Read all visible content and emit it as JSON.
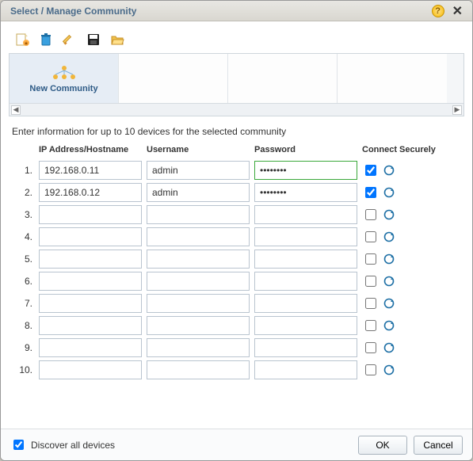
{
  "title": "Select / Manage Community",
  "toolbar": {
    "items": [
      {
        "name": "new-icon"
      },
      {
        "name": "delete-icon"
      },
      {
        "name": "edit-icon"
      },
      {
        "name": "save-icon"
      },
      {
        "name": "open-icon"
      }
    ]
  },
  "community": {
    "new_label": "New Community"
  },
  "scroll": {
    "left": "◀",
    "right": "▶"
  },
  "prompt": "Enter information for up to 10 devices for the selected community",
  "headers": {
    "ip": "IP Address/Hostname",
    "user": "Username",
    "pass": "Password",
    "secure": "Connect Securely"
  },
  "rows": [
    {
      "n": "1.",
      "ip": "192.168.0.11",
      "user": "admin",
      "pass": "********",
      "secure": true,
      "highlight": true
    },
    {
      "n": "2.",
      "ip": "192.168.0.12",
      "user": "admin",
      "pass": "********",
      "secure": true,
      "highlight": false
    },
    {
      "n": "3.",
      "ip": "",
      "user": "",
      "pass": "",
      "secure": false,
      "highlight": false
    },
    {
      "n": "4.",
      "ip": "",
      "user": "",
      "pass": "",
      "secure": false,
      "highlight": false
    },
    {
      "n": "5.",
      "ip": "",
      "user": "",
      "pass": "",
      "secure": false,
      "highlight": false
    },
    {
      "n": "6.",
      "ip": "",
      "user": "",
      "pass": "",
      "secure": false,
      "highlight": false
    },
    {
      "n": "7.",
      "ip": "",
      "user": "",
      "pass": "",
      "secure": false,
      "highlight": false
    },
    {
      "n": "8.",
      "ip": "",
      "user": "",
      "pass": "",
      "secure": false,
      "highlight": false
    },
    {
      "n": "9.",
      "ip": "",
      "user": "",
      "pass": "",
      "secure": false,
      "highlight": false
    },
    {
      "n": "10.",
      "ip": "",
      "user": "",
      "pass": "",
      "secure": false,
      "highlight": false
    }
  ],
  "footer": {
    "discover_label": "Discover all devices",
    "discover_checked": true,
    "ok": "OK",
    "cancel": "Cancel"
  }
}
